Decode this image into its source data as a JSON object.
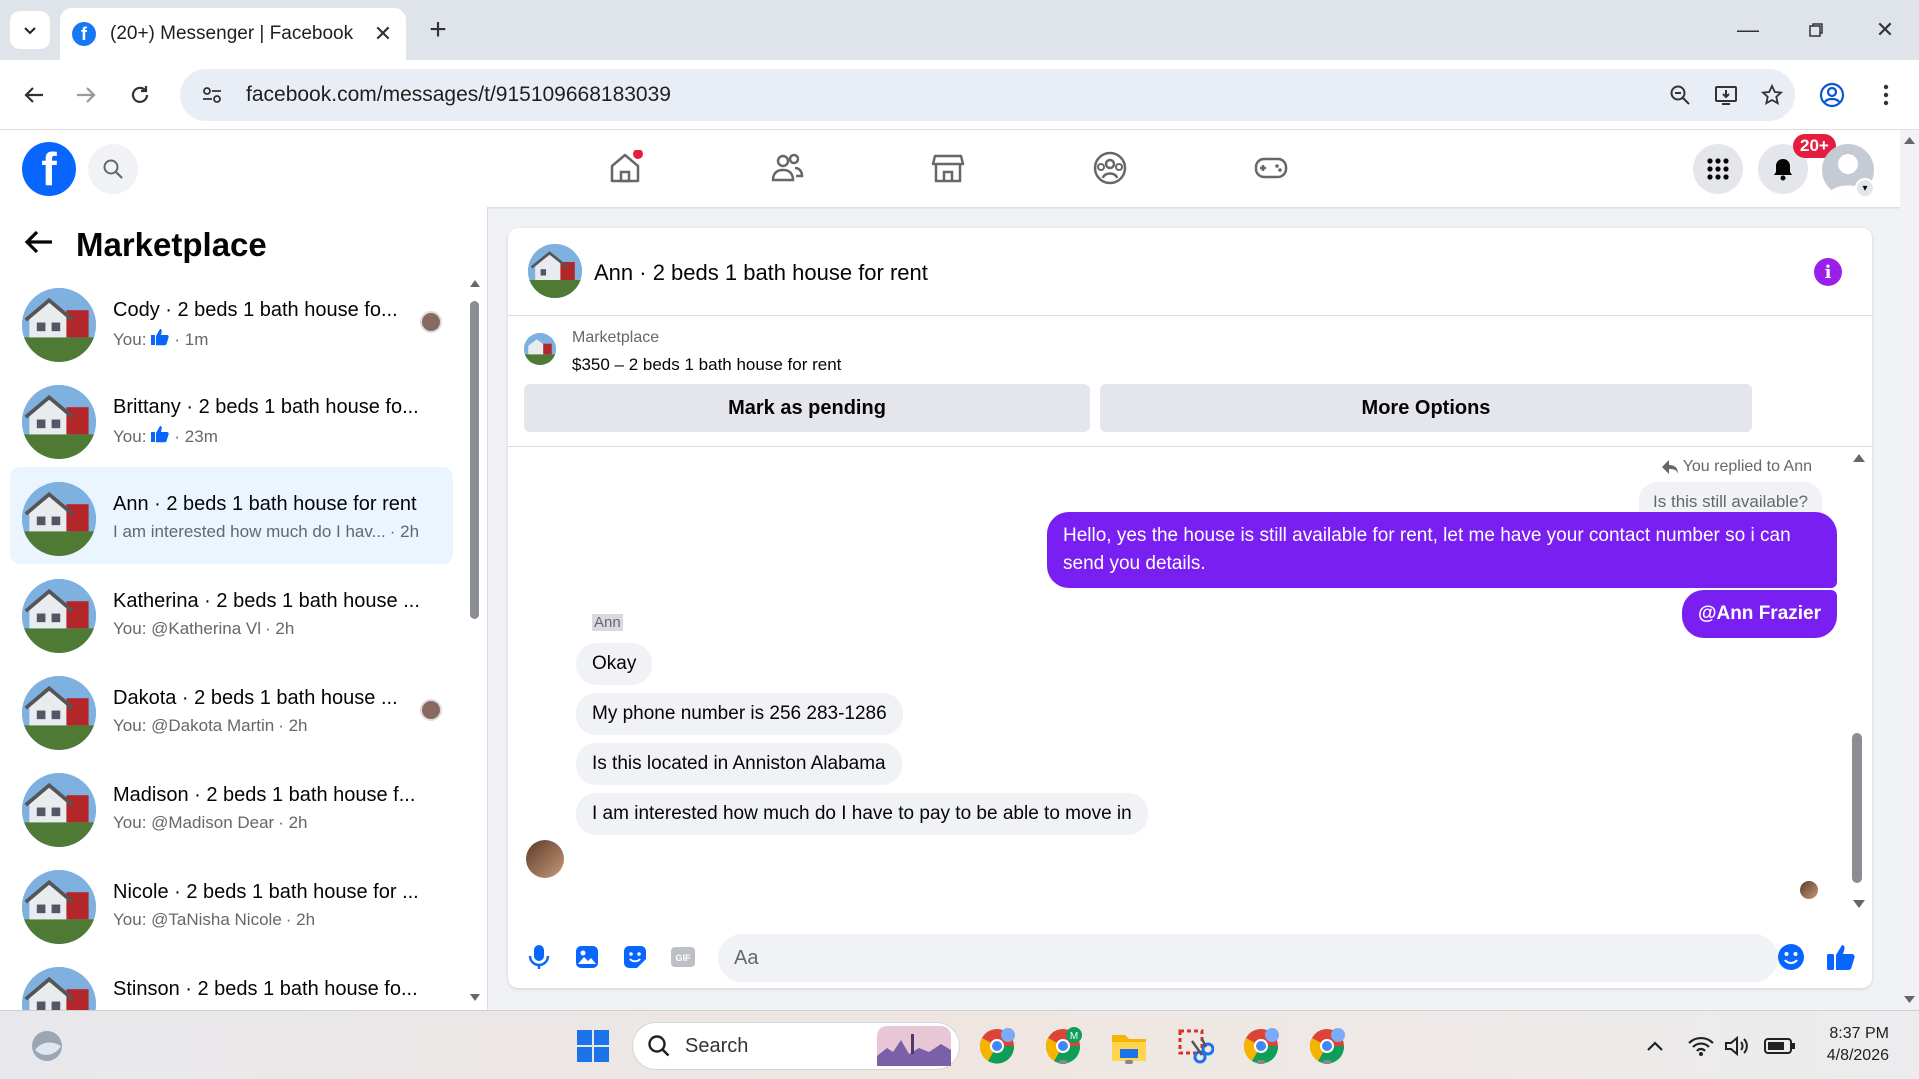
{
  "browser": {
    "tab_title": "(20+) Messenger | Facebook",
    "url": "facebook.com/messages/t/915109668183039"
  },
  "fb_header": {
    "notification_count": "20+"
  },
  "sidebar": {
    "title": "Marketplace",
    "conversations": [
      {
        "name": "Cody · 2 beds 1 bath house fo...",
        "sub_prefix": "You:",
        "sub_text": "",
        "time": "· 1m",
        "like": true,
        "seen": true,
        "active": false
      },
      {
        "name": "Brittany · 2 beds 1 bath house fo...",
        "sub_prefix": "You:",
        "sub_text": "",
        "time": "· 23m",
        "like": true,
        "seen": false,
        "active": false
      },
      {
        "name": "Ann · 2 beds 1 bath house for rent",
        "sub_prefix": "",
        "sub_text": "I am interested how much do I hav...",
        "time": "· 2h",
        "like": false,
        "seen": false,
        "active": true
      },
      {
        "name": "Katherina · 2 beds 1 bath house ...",
        "sub_prefix": "",
        "sub_text": "You: @Katherina Vl",
        "time": "· 2h",
        "like": false,
        "seen": false,
        "active": false
      },
      {
        "name": "Dakota · 2 beds 1 bath house ...",
        "sub_prefix": "",
        "sub_text": "You: @Dakota Martin",
        "time": "· 2h",
        "like": false,
        "seen": true,
        "active": false
      },
      {
        "name": "Madison · 2 beds 1 bath house f...",
        "sub_prefix": "",
        "sub_text": "You: @Madison Dear",
        "time": "· 2h",
        "like": false,
        "seen": false,
        "active": false
      },
      {
        "name": "Nicole · 2 beds 1 bath house for ...",
        "sub_prefix": "",
        "sub_text": "You: @TaNisha Nicole",
        "time": "· 2h",
        "like": false,
        "seen": false,
        "active": false
      },
      {
        "name": "Stinson · 2 beds 1 bath house fo...",
        "sub_prefix": "",
        "sub_text": "",
        "time": "",
        "like": false,
        "seen": false,
        "active": false
      }
    ]
  },
  "chat": {
    "title": "Ann · 2 beds 1 bath house for rent",
    "marketplace_label": "Marketplace",
    "listing": "$350 – 2 beds 1 bath house for rent",
    "mark_pending_label": "Mark as pending",
    "more_options_label": "More Options",
    "replied_label": "You replied to Ann",
    "quoted_text": "Is this still available?",
    "outgoing": [
      "Hello, yes the house is still available for rent, let me have your contact number so i can send you details.",
      "@Ann Frazier"
    ],
    "sender_name": "Ann",
    "incoming": [
      "Okay",
      "My phone number is 256 283-1286",
      "Is this located in Anniston Alabama",
      "I am interested how much do I have to pay to be able to move in"
    ],
    "composer_placeholder": "Aa"
  },
  "taskbar": {
    "search_label": "Search",
    "time": "8:37 PM",
    "date": "4/8/2026"
  },
  "colors": {
    "accent_purple": "#7a1ff2",
    "facebook_blue": "#0866ff",
    "badge_red": "#e41e3f"
  }
}
